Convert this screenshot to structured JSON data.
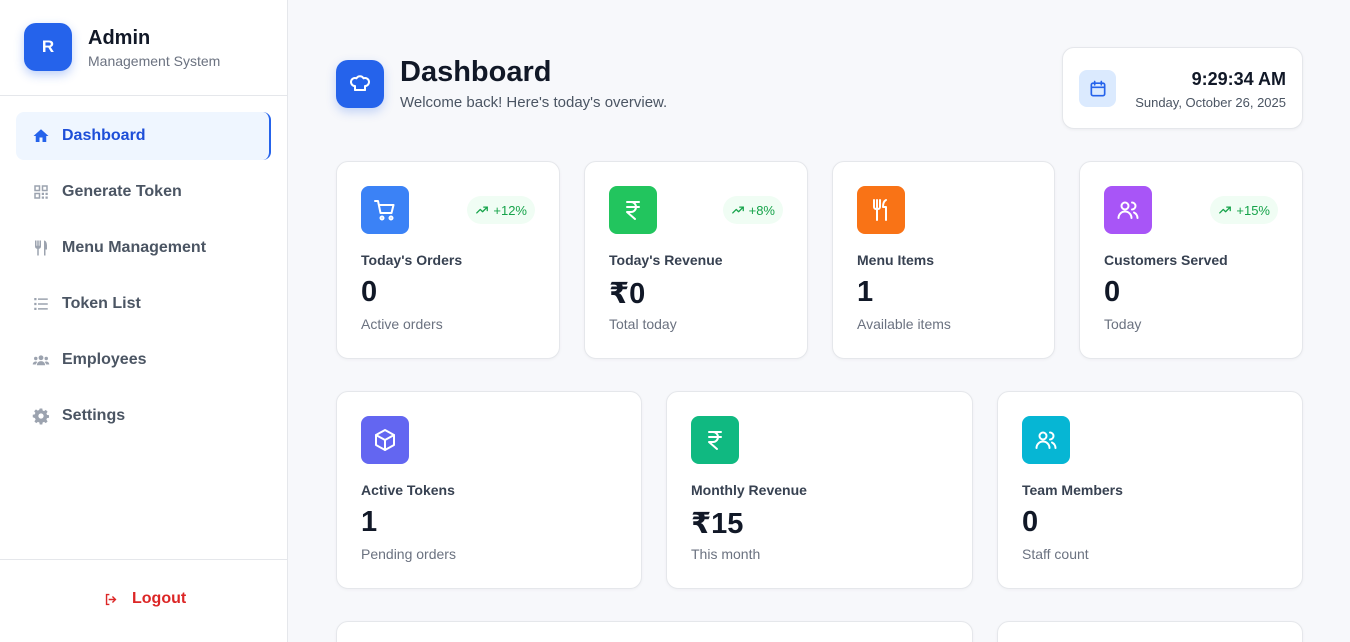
{
  "brand": {
    "logo_letter": "R",
    "title": "Admin",
    "subtitle": "Management System",
    "accent": "#2563eb"
  },
  "nav": {
    "items": [
      {
        "label": "Dashboard",
        "icon": "home-icon",
        "active": true
      },
      {
        "label": "Generate Token",
        "icon": "qr-code-icon",
        "active": false
      },
      {
        "label": "Menu Management",
        "icon": "utensils-icon",
        "active": false
      },
      {
        "label": "Token List",
        "icon": "list-icon",
        "active": false
      },
      {
        "label": "Employees",
        "icon": "users-icon",
        "active": false
      },
      {
        "label": "Settings",
        "icon": "gear-icon",
        "active": false
      }
    ],
    "logout_label": "Logout"
  },
  "header": {
    "title": "Dashboard",
    "subtitle": "Welcome back! Here's today's overview.",
    "icon": "chef-hat-icon"
  },
  "clock": {
    "time": "9:29:34 AM",
    "date": "Sunday, October 26, 2025",
    "icon": "calendar-icon"
  },
  "stats_top": [
    {
      "label": "Today's Orders",
      "value": "0",
      "sub": "Active orders",
      "trend": "+12%",
      "icon": "cart-icon",
      "color": "#3b82f6"
    },
    {
      "label": "Today's Revenue",
      "value": "₹0",
      "sub": "Total today",
      "trend": "+8%",
      "icon": "rupee-icon",
      "color": "#22c55e"
    },
    {
      "label": "Menu Items",
      "value": "1",
      "sub": "Available items",
      "trend": "",
      "icon": "utensils-icon",
      "color": "#f97316"
    },
    {
      "label": "Customers Served",
      "value": "0",
      "sub": "Today",
      "trend": "+15%",
      "icon": "users-icon",
      "color": "#a855f7"
    }
  ],
  "stats_bottom": [
    {
      "label": "Active Tokens",
      "value": "1",
      "sub": "Pending orders",
      "icon": "package-icon",
      "color": "#6366f1"
    },
    {
      "label": "Monthly Revenue",
      "value": "₹15",
      "sub": "This month",
      "icon": "rupee-icon",
      "color": "#10b981"
    },
    {
      "label": "Team Members",
      "value": "0",
      "sub": "Staff count",
      "icon": "users-icon",
      "color": "#06b6d4"
    }
  ]
}
